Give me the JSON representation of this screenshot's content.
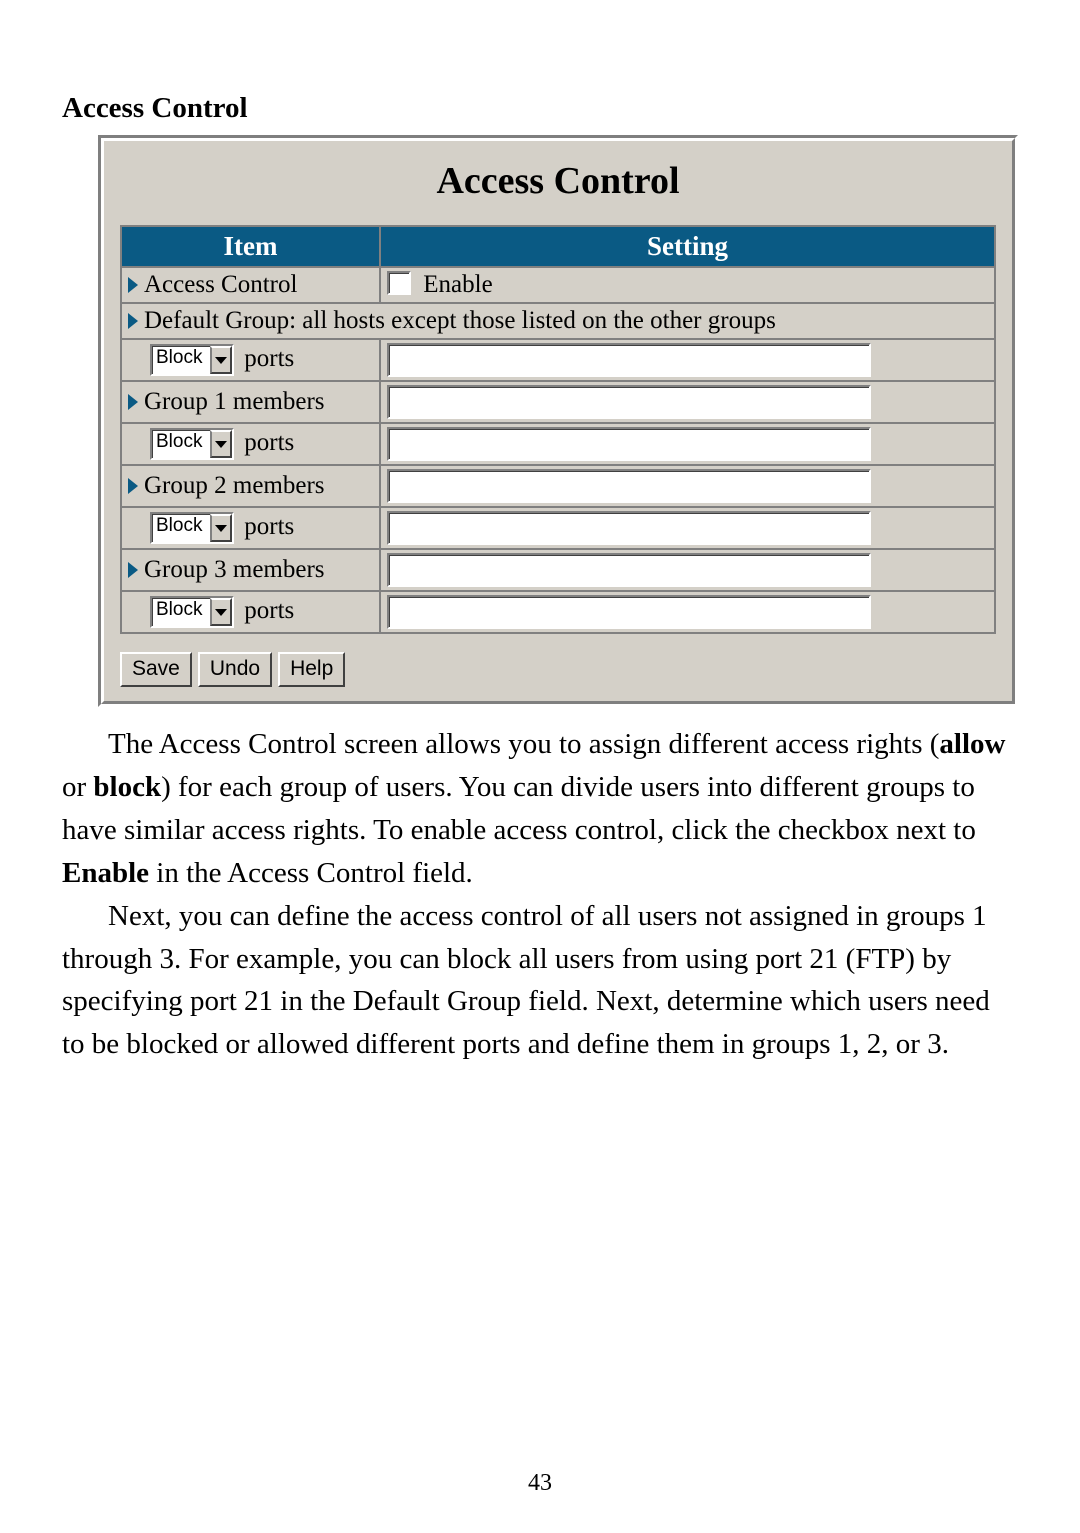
{
  "section_title": "Access Control",
  "panel_title": "Access Control",
  "table": {
    "header_item": "Item",
    "header_setting": "Setting"
  },
  "rows": {
    "access_control_label": "Access Control",
    "enable_label": " Enable",
    "default_group_text": "Default Group: all hosts except those listed on the other groups",
    "default_ports_action": "Block",
    "default_ports_label": " ports",
    "default_ports_value": "",
    "group1_label": "Group 1 members",
    "group1_value": "",
    "group1_ports_action": "Block",
    "group1_ports_label": " ports",
    "group1_ports_value": "",
    "group2_label": "Group 2 members",
    "group2_value": "",
    "group2_ports_action": "Block",
    "group2_ports_label": " ports",
    "group2_ports_value": "",
    "group3_label": "Group 3 members",
    "group3_value": "",
    "group3_ports_action": "Block",
    "group3_ports_label": " ports",
    "group3_ports_value": ""
  },
  "buttons": {
    "save": "Save",
    "undo": "Undo",
    "help": "Help"
  },
  "paragraphs": {
    "p1_a": "The Access Control screen allows you to assign different access rights (",
    "p1_b1": "allow",
    "p1_c": " or ",
    "p1_b2": "block",
    "p1_d": ") for each group of users. You can divide users into different groups to have similar access rights. To enable access control, click the checkbox next to ",
    "p1_b3": "Enable",
    "p1_e": " in the Access Control field.",
    "p2": "Next, you can define the access control of all users not assigned in groups 1 through 3. For example, you can block all users from using port 21 (FTP) by specifying port 21 in the Default Group field. Next, determine which users need to be blocked or allowed different ports and define them in groups 1, 2, or 3."
  },
  "page_number": "43"
}
